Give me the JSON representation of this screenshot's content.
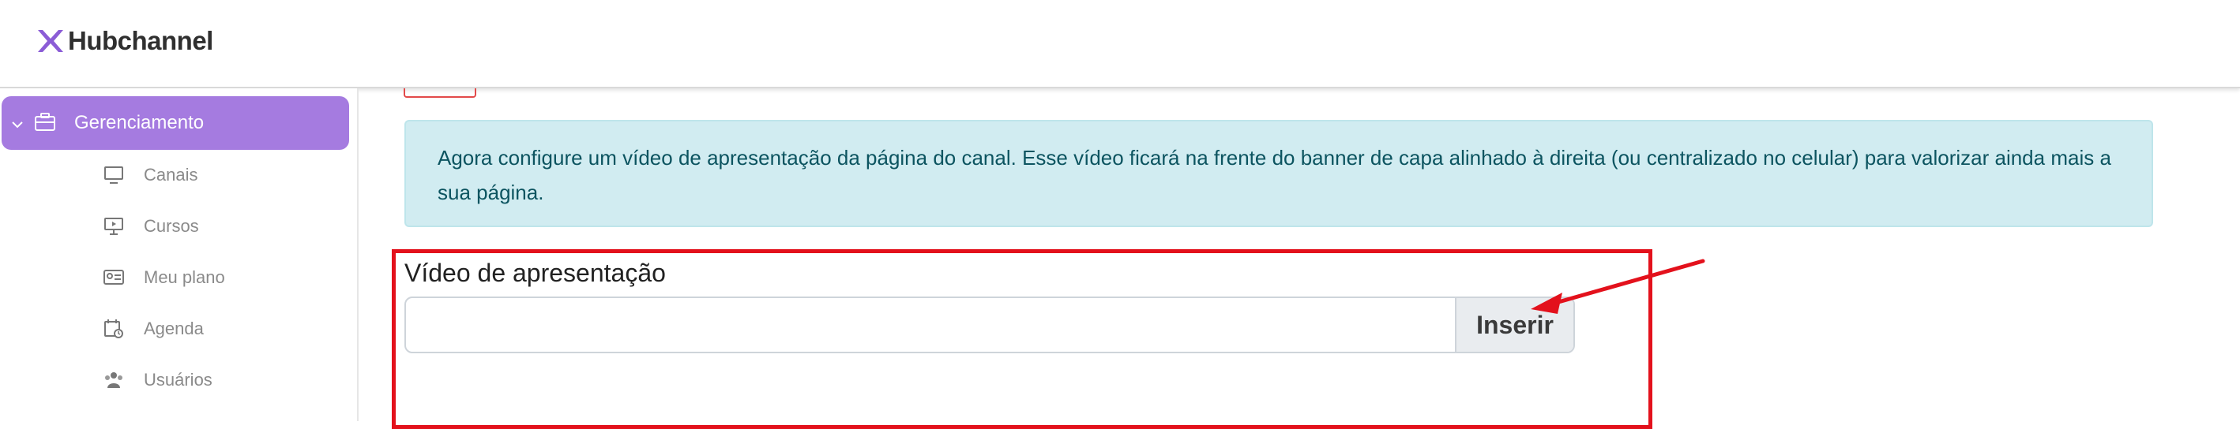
{
  "header": {
    "brand_name": "Hubchannel",
    "brand_color": "#8b5cd6"
  },
  "sidebar": {
    "active_item": {
      "label": "Gerenciamento",
      "icon": "briefcase-icon",
      "color": "#a57be0"
    },
    "items": [
      {
        "label": "Canais",
        "icon": "monitor-icon"
      },
      {
        "label": "Cursos",
        "icon": "presentation-icon"
      },
      {
        "label": "Meu plano",
        "icon": "id-card-icon"
      },
      {
        "label": "Agenda",
        "icon": "calendar-clock-icon"
      },
      {
        "label": "Usuários",
        "icon": "users-icon"
      }
    ]
  },
  "main": {
    "info_text": "Agora configure um vídeo de apresentação da página do canal. Esse vídeo ficará na frente do banner de capa alinhado à direita (ou centralizado no celular) para valorizar ainda mais a sua página.",
    "video_field": {
      "label": "Vídeo de apresentação",
      "value": "",
      "button_label": "Inserir"
    },
    "annotation_color": "#e3111c"
  }
}
